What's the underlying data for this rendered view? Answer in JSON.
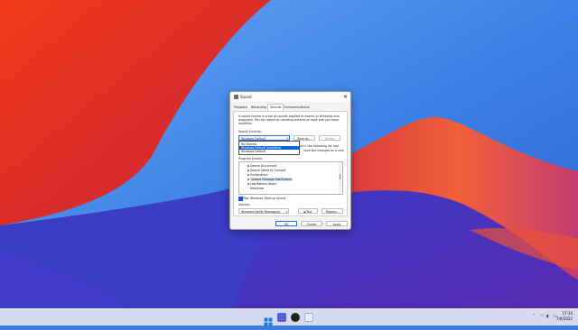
{
  "dialog": {
    "title": "Sound",
    "close": "✕",
    "tabs": [
      "Playback",
      "Recording",
      "Sounds",
      "Communications"
    ],
    "active_tab": "Sounds",
    "description": "A sound theme is a set of sounds applied to events in Windows and programs. You can select an existing scheme or save one you have modified.",
    "scheme_label": "Sound Scheme:",
    "scheme_value": "Windows Default",
    "scheme_options": [
      "No Sounds",
      "Windows Default (modified)",
      "Windows Default"
    ],
    "save_as": "Save As...",
    "delete": "Delete",
    "partial_text_1": "nt in the following list and",
    "partial_text_2": "save the changes as a new",
    "program_events_label": "Program Events:",
    "events": [
      "Device Disconnect",
      "Device Failed to Connect",
      "Exclamation",
      "Instant Message Notification",
      "Low Battery Alarm",
      "Maximize"
    ],
    "selected_event": "Instant Message Notification",
    "play_startup_label": "Play Windows Startup sound",
    "sounds_label": "Sounds:",
    "sound_value": "Windows Notify Messaging",
    "test": "Test",
    "browse": "Browse...",
    "ok": "OK",
    "cancel": "Cancel",
    "apply": "Apply"
  },
  "taskbar": {
    "time": "17:34",
    "date": "7/8/2022",
    "icons": [
      "windows-start-icon",
      "teams-icon",
      "chrome-icon",
      "speaker-app-icon"
    ],
    "tray": [
      "chevron-up-icon",
      "wifi-icon",
      "volume-icon",
      "battery-icon"
    ]
  },
  "colors": {
    "accent": "#0a64d0",
    "wallpaper_red": "#e8311d",
    "wallpaper_blue": "#3a7fe0"
  }
}
